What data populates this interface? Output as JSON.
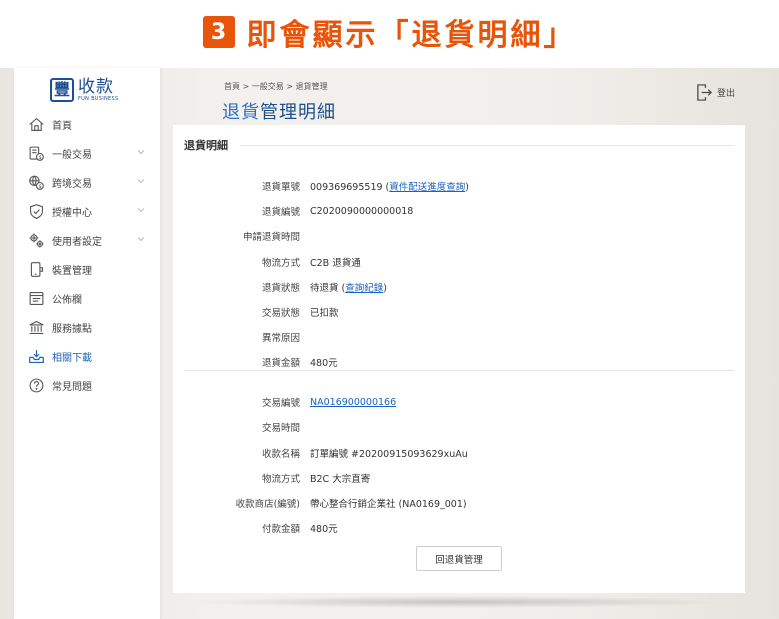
{
  "banner": {
    "step": "3",
    "text": "即會顯示「退貨明細」"
  },
  "logo": {
    "mark": "豐",
    "title": "收款",
    "subtitle": "FUN BUSINESS"
  },
  "nav": [
    {
      "label": "首頁",
      "icon": "home-icon",
      "chevron": false,
      "active": false
    },
    {
      "label": "一般交易",
      "icon": "receipt-icon",
      "chevron": true,
      "active": false
    },
    {
      "label": "跨境交易",
      "icon": "globe-currency-icon",
      "chevron": true,
      "active": false
    },
    {
      "label": "授權中心",
      "icon": "shield-check-icon",
      "chevron": true,
      "active": false
    },
    {
      "label": "使用者設定",
      "icon": "gears-icon",
      "chevron": true,
      "active": false
    },
    {
      "label": "裝置管理",
      "icon": "mobile-device-icon",
      "chevron": false,
      "active": false
    },
    {
      "label": "公佈欄",
      "icon": "bulletin-icon",
      "chevron": false,
      "active": false
    },
    {
      "label": "服務據點",
      "icon": "bank-icon",
      "chevron": false,
      "active": false
    },
    {
      "label": "相關下載",
      "icon": "download-tray-icon",
      "chevron": false,
      "active": true
    },
    {
      "label": "常見問題",
      "icon": "question-icon",
      "chevron": false,
      "active": false
    }
  ],
  "header": {
    "breadcrumb": "首頁 > 一般交易 > 退貨管理",
    "title_highlight": "退貨",
    "title_rest": "管理明細",
    "logout": "登出"
  },
  "card": {
    "heading": "退貨明細",
    "return_section": {
      "return_no_label": "退貨單號",
      "return_no": "009369695519",
      "return_no_link_prefix": " (",
      "return_no_link": "資件配送進度查詢",
      "return_no_link_suffix": ")",
      "return_id_label": "退貨編號",
      "return_id": "C2020090000000018",
      "apply_time_label": "申請退貨時間",
      "apply_time": "",
      "logistics_label": "物流方式",
      "logistics": "C2B 退貨通",
      "status_label": "退貨狀態",
      "status": "待退貨 (",
      "status_link": "查詢紀錄",
      "status_suffix": ")",
      "trade_status_label": "交易狀態",
      "trade_status": "已扣款",
      "error_label": "異常原因",
      "error": "",
      "amount_label": "退貨金額",
      "amount": "480元"
    },
    "trade_section": {
      "trade_no_label": "交易編號",
      "trade_no": "NA016900000166",
      "trade_time_label": "交易時間",
      "trade_time": "",
      "payee_label": "收款名稱",
      "payee": "訂單編號 #20200915093629xuAu",
      "logistics_label": "物流方式",
      "logistics": "B2C 大宗直寄",
      "merchant_label": "收款商店(編號)",
      "merchant": "帶心整合行銷企業社 (NA0169_001)",
      "pay_amount_label": "付款金額",
      "pay_amount": "480元"
    },
    "back_button": "回退貨管理"
  },
  "colors": {
    "accent_orange": "#e8540a",
    "brand_blue": "#1d4f96",
    "link_blue": "#1a62c4",
    "amount_red": "#e0332b"
  }
}
